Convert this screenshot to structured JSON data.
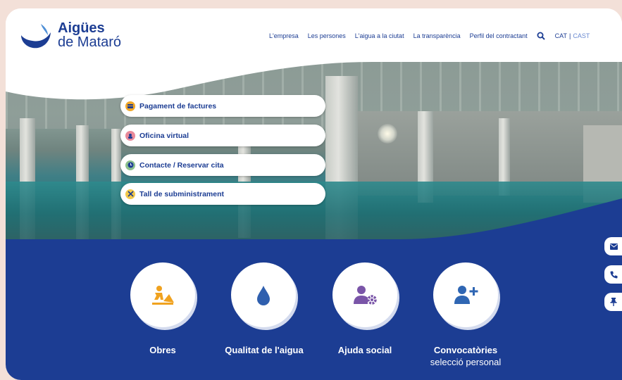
{
  "logo": {
    "line1": "Aigües",
    "line2": "de Mataró"
  },
  "nav": {
    "items": [
      "L'empresa",
      "Les persones",
      "L'aigua a la ciutat",
      "La transparència",
      "Perfil del contractant"
    ],
    "search_icon": "search-icon",
    "lang_active": "CAT",
    "lang_separator": "|",
    "lang_inactive": "CAST"
  },
  "quick_links": [
    {
      "label": "Pagament de factures",
      "icon": "invoice-icon",
      "color": "#f0a82a"
    },
    {
      "label": "Oficina virtual",
      "icon": "virtual-office-icon",
      "color": "#e98a9a"
    },
    {
      "label": "Contacte / Reservar cita",
      "icon": "clock-icon",
      "color": "#8cc08d"
    },
    {
      "label": "Tall de subministrament",
      "icon": "tools-icon",
      "color": "#f2c94c"
    }
  ],
  "services": [
    {
      "title": "Obres",
      "subtitle": "",
      "icon": "construction-worker-icon",
      "icon_color": "#f0a21f"
    },
    {
      "title": "Qualitat de l'aigua",
      "subtitle": "",
      "icon": "water-drop-icon",
      "icon_color": "#2f5fae"
    },
    {
      "title": "Ajuda social",
      "subtitle": "",
      "icon": "user-gear-icon",
      "icon_color": "#7a55a8"
    },
    {
      "title": "Convocatòries",
      "subtitle": "selecció personal",
      "icon": "user-plus-icon",
      "icon_color": "#2f66b3"
    }
  ],
  "side_buttons": [
    "envelope-icon",
    "phone-icon",
    "pin-icon"
  ],
  "colors": {
    "brand_blue": "#1c3d93",
    "background": "#f3e0d8"
  }
}
